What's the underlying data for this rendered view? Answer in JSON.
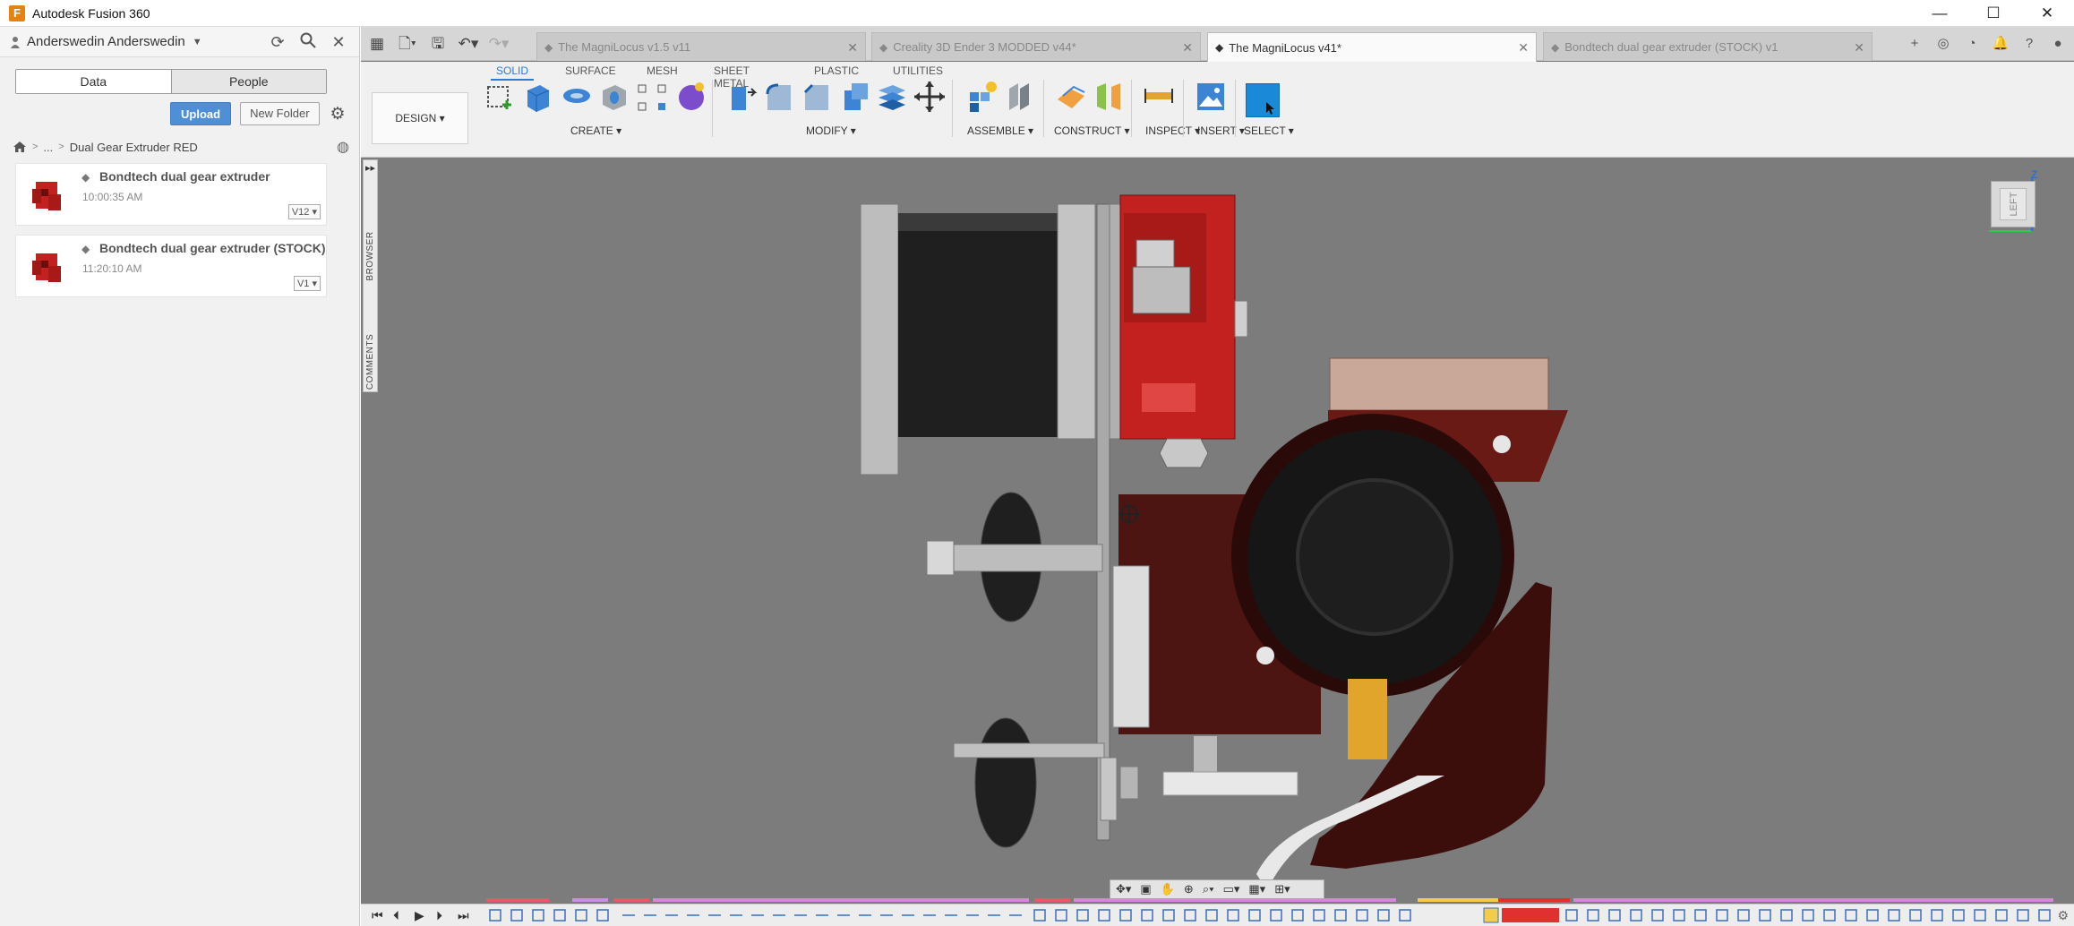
{
  "app": {
    "title": "Autodesk Fusion 360",
    "logo": "F"
  },
  "window_controls": {
    "minimize": "—",
    "maximize": "☐",
    "close": "✕"
  },
  "left_panel": {
    "user": "Anderswedin Anderswedin",
    "tabs": {
      "data": "Data",
      "people": "People"
    },
    "buttons": {
      "upload": "Upload",
      "new_folder": "New Folder"
    },
    "breadcrumb": {
      "ellipsis": "...",
      "folder": "Dual Gear Extruder RED"
    },
    "files": [
      {
        "name": "Bondtech dual gear extruder",
        "time": "10:00:35 AM",
        "version": "V12 ▾"
      },
      {
        "name": "Bondtech dual gear extruder (STOCK)",
        "time": "11:20:10 AM",
        "version": "V1 ▾"
      }
    ]
  },
  "doc_tabs": [
    {
      "title": "The MagniLocus v1.5 v11",
      "active": false
    },
    {
      "title": "Creality 3D Ender 3 MODDED v44*",
      "active": false
    },
    {
      "title": "The MagniLocus v41*",
      "active": true
    },
    {
      "title": "Bondtech dual gear extruder (STOCK) v1",
      "active": false
    }
  ],
  "toolbar": {
    "workspace": "DESIGN ▾",
    "tabs": [
      "SOLID",
      "SURFACE",
      "MESH",
      "SHEET METAL",
      "PLASTIC",
      "UTILITIES"
    ],
    "groups": {
      "create": "CREATE ▾",
      "modify": "MODIFY ▾",
      "assemble": "ASSEMBLE ▾",
      "construct": "CONSTRUCT ▾",
      "inspect": "INSPECT ▾",
      "insert": "INSERT ▾",
      "select": "SELECT ▾"
    }
  },
  "viewport": {
    "browser_label": "BROWSER",
    "comments_label": "COMMENTS",
    "viewcube_face": "LEFT",
    "axis_z": "Z"
  },
  "colors": {
    "accent": "#2a7bd1",
    "select_blue": "#1a8ad8",
    "upload_blue": "#4f8fd6",
    "part_red": "#c3211f",
    "dark_red": "#5a1712",
    "viewport_gray": "#7c7c7c"
  }
}
